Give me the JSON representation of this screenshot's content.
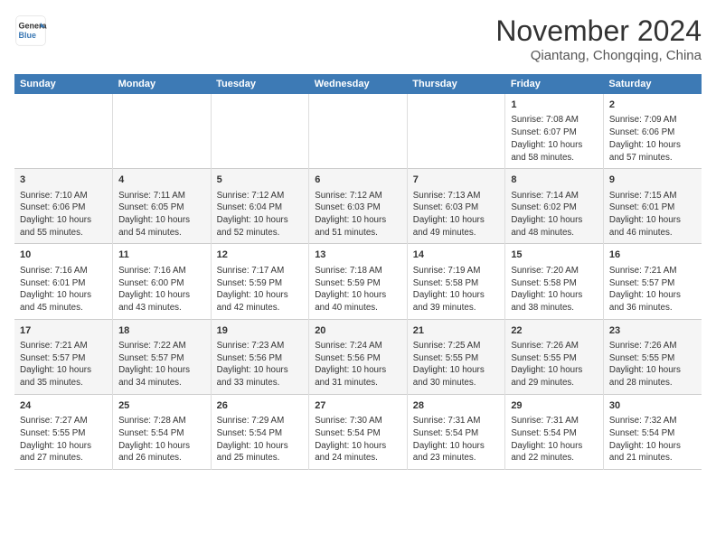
{
  "header": {
    "logo_line1": "General",
    "logo_line2": "Blue",
    "month": "November 2024",
    "location": "Qiantang, Chongqing, China"
  },
  "days_of_week": [
    "Sunday",
    "Monday",
    "Tuesday",
    "Wednesday",
    "Thursday",
    "Friday",
    "Saturday"
  ],
  "weeks": [
    [
      {
        "day": "",
        "info": ""
      },
      {
        "day": "",
        "info": ""
      },
      {
        "day": "",
        "info": ""
      },
      {
        "day": "",
        "info": ""
      },
      {
        "day": "",
        "info": ""
      },
      {
        "day": "1",
        "info": "Sunrise: 7:08 AM\nSunset: 6:07 PM\nDaylight: 10 hours and 58 minutes."
      },
      {
        "day": "2",
        "info": "Sunrise: 7:09 AM\nSunset: 6:06 PM\nDaylight: 10 hours and 57 minutes."
      }
    ],
    [
      {
        "day": "3",
        "info": "Sunrise: 7:10 AM\nSunset: 6:06 PM\nDaylight: 10 hours and 55 minutes."
      },
      {
        "day": "4",
        "info": "Sunrise: 7:11 AM\nSunset: 6:05 PM\nDaylight: 10 hours and 54 minutes."
      },
      {
        "day": "5",
        "info": "Sunrise: 7:12 AM\nSunset: 6:04 PM\nDaylight: 10 hours and 52 minutes."
      },
      {
        "day": "6",
        "info": "Sunrise: 7:12 AM\nSunset: 6:03 PM\nDaylight: 10 hours and 51 minutes."
      },
      {
        "day": "7",
        "info": "Sunrise: 7:13 AM\nSunset: 6:03 PM\nDaylight: 10 hours and 49 minutes."
      },
      {
        "day": "8",
        "info": "Sunrise: 7:14 AM\nSunset: 6:02 PM\nDaylight: 10 hours and 48 minutes."
      },
      {
        "day": "9",
        "info": "Sunrise: 7:15 AM\nSunset: 6:01 PM\nDaylight: 10 hours and 46 minutes."
      }
    ],
    [
      {
        "day": "10",
        "info": "Sunrise: 7:16 AM\nSunset: 6:01 PM\nDaylight: 10 hours and 45 minutes."
      },
      {
        "day": "11",
        "info": "Sunrise: 7:16 AM\nSunset: 6:00 PM\nDaylight: 10 hours and 43 minutes."
      },
      {
        "day": "12",
        "info": "Sunrise: 7:17 AM\nSunset: 5:59 PM\nDaylight: 10 hours and 42 minutes."
      },
      {
        "day": "13",
        "info": "Sunrise: 7:18 AM\nSunset: 5:59 PM\nDaylight: 10 hours and 40 minutes."
      },
      {
        "day": "14",
        "info": "Sunrise: 7:19 AM\nSunset: 5:58 PM\nDaylight: 10 hours and 39 minutes."
      },
      {
        "day": "15",
        "info": "Sunrise: 7:20 AM\nSunset: 5:58 PM\nDaylight: 10 hours and 38 minutes."
      },
      {
        "day": "16",
        "info": "Sunrise: 7:21 AM\nSunset: 5:57 PM\nDaylight: 10 hours and 36 minutes."
      }
    ],
    [
      {
        "day": "17",
        "info": "Sunrise: 7:21 AM\nSunset: 5:57 PM\nDaylight: 10 hours and 35 minutes."
      },
      {
        "day": "18",
        "info": "Sunrise: 7:22 AM\nSunset: 5:57 PM\nDaylight: 10 hours and 34 minutes."
      },
      {
        "day": "19",
        "info": "Sunrise: 7:23 AM\nSunset: 5:56 PM\nDaylight: 10 hours and 33 minutes."
      },
      {
        "day": "20",
        "info": "Sunrise: 7:24 AM\nSunset: 5:56 PM\nDaylight: 10 hours and 31 minutes."
      },
      {
        "day": "21",
        "info": "Sunrise: 7:25 AM\nSunset: 5:55 PM\nDaylight: 10 hours and 30 minutes."
      },
      {
        "day": "22",
        "info": "Sunrise: 7:26 AM\nSunset: 5:55 PM\nDaylight: 10 hours and 29 minutes."
      },
      {
        "day": "23",
        "info": "Sunrise: 7:26 AM\nSunset: 5:55 PM\nDaylight: 10 hours and 28 minutes."
      }
    ],
    [
      {
        "day": "24",
        "info": "Sunrise: 7:27 AM\nSunset: 5:55 PM\nDaylight: 10 hours and 27 minutes."
      },
      {
        "day": "25",
        "info": "Sunrise: 7:28 AM\nSunset: 5:54 PM\nDaylight: 10 hours and 26 minutes."
      },
      {
        "day": "26",
        "info": "Sunrise: 7:29 AM\nSunset: 5:54 PM\nDaylight: 10 hours and 25 minutes."
      },
      {
        "day": "27",
        "info": "Sunrise: 7:30 AM\nSunset: 5:54 PM\nDaylight: 10 hours and 24 minutes."
      },
      {
        "day": "28",
        "info": "Sunrise: 7:31 AM\nSunset: 5:54 PM\nDaylight: 10 hours and 23 minutes."
      },
      {
        "day": "29",
        "info": "Sunrise: 7:31 AM\nSunset: 5:54 PM\nDaylight: 10 hours and 22 minutes."
      },
      {
        "day": "30",
        "info": "Sunrise: 7:32 AM\nSunset: 5:54 PM\nDaylight: 10 hours and 21 minutes."
      }
    ]
  ]
}
